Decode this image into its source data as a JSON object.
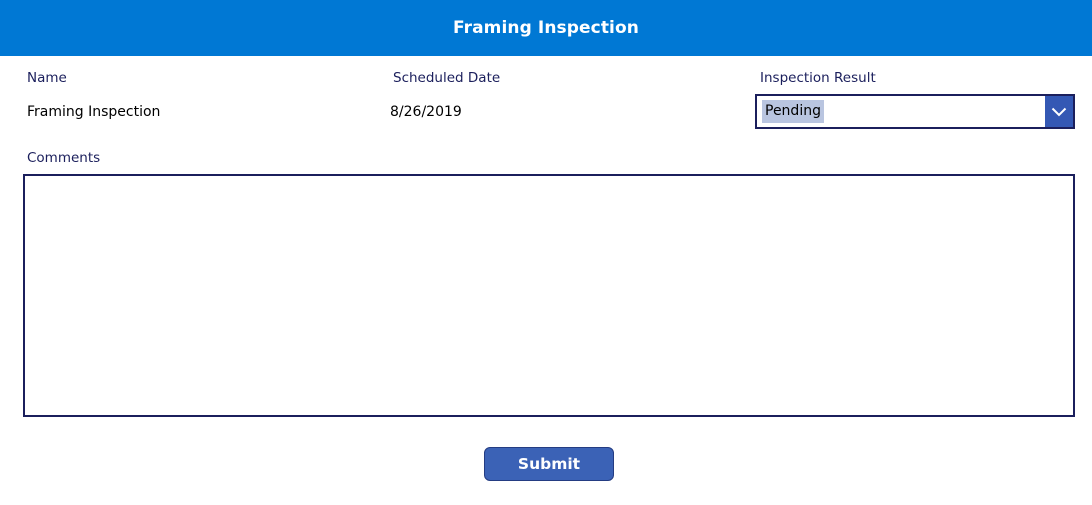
{
  "header": {
    "title": "Framing Inspection"
  },
  "fields": {
    "name_label": "Name",
    "name_value": "Framing Inspection",
    "scheduled_date_label": "Scheduled Date",
    "scheduled_date_value": "8/26/2019",
    "inspection_result_label": "Inspection Result",
    "inspection_result_value": "Pending",
    "comments_label": "Comments",
    "comments_value": ""
  },
  "actions": {
    "submit_label": "Submit"
  },
  "colors": {
    "header_bg": "#0078d4",
    "label_text": "#1b1f5c",
    "border": "#1b1f5c",
    "dropdown_chevron_bg": "#3458b4",
    "selected_highlight": "#b9c5e0",
    "button_bg": "#3b62b6"
  },
  "icons": {
    "dropdown": "chevron-down-icon"
  }
}
